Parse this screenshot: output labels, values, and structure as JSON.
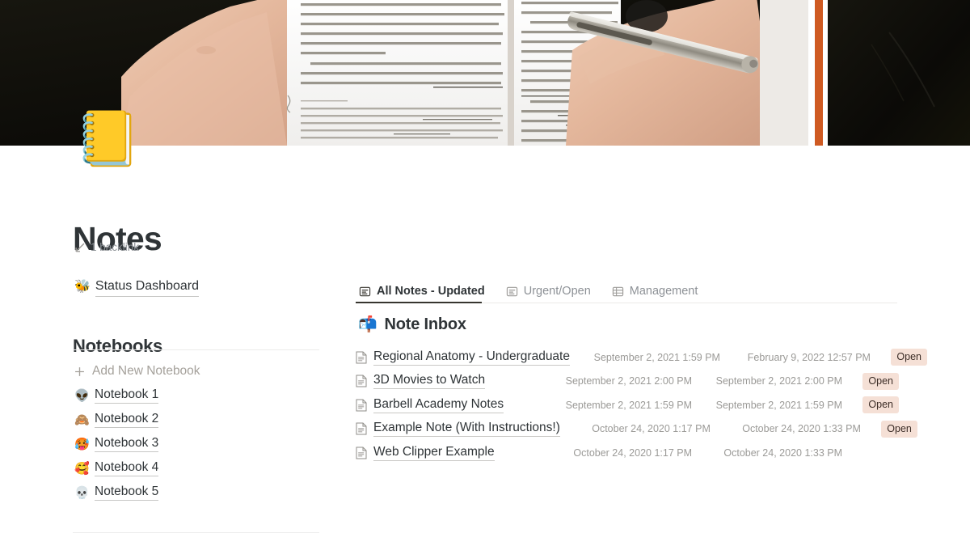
{
  "cover": {
    "alt": "hands writing with a pen in an open book"
  },
  "page": {
    "icon_emoji": "📒",
    "icon_name": "notebook-emoji",
    "title": "Notes",
    "backlink_label": "1 backlink"
  },
  "status_link": {
    "emoji": "🐝",
    "label": "Status Dashboard"
  },
  "notebooks": {
    "heading": "Notebooks",
    "add_label": "Add New Notebook",
    "items": [
      {
        "emoji": "👽",
        "label": "Notebook 1"
      },
      {
        "emoji": "🙈",
        "label": "Notebook 2"
      },
      {
        "emoji": "🥵",
        "label": "Notebook 3"
      },
      {
        "emoji": "🥰",
        "label": "Notebook 4"
      },
      {
        "emoji": "💀",
        "label": "Notebook 5"
      }
    ]
  },
  "tabs": [
    {
      "label": "All Notes - Updated",
      "icon": "list-view-icon",
      "active": true
    },
    {
      "label": "Urgent/Open",
      "icon": "list-view-icon",
      "active": false
    },
    {
      "label": "Management",
      "icon": "table-view-icon",
      "active": false
    }
  ],
  "inbox": {
    "emoji": "📬",
    "heading": "Note Inbox",
    "rows": [
      {
        "name": "Regional Anatomy - Undergraduate",
        "created": "September 2, 2021 1:59 PM",
        "updated": "February 9, 2022 12:57 PM",
        "status": "Open"
      },
      {
        "name": "3D Movies to Watch",
        "created": "September 2, 2021 2:00 PM",
        "updated": "September 2, 2021 2:00 PM",
        "status": "Open"
      },
      {
        "name": "Barbell Academy Notes",
        "created": "September 2, 2021 1:59 PM",
        "updated": "September 2, 2021 1:59 PM",
        "status": "Open"
      },
      {
        "name": "Example Note (With Instructions!)",
        "created": "October 24, 2020 1:17 PM",
        "updated": "October 24, 2020 1:33 PM",
        "status": "Open"
      },
      {
        "name": "Web Clipper Example",
        "created": "October 24, 2020 1:17 PM",
        "updated": "October 24, 2020 1:33 PM",
        "status": ""
      }
    ]
  },
  "colors": {
    "text": "#2f3437",
    "muted": "#9b9a97",
    "badge_bg": "#f5e0d6",
    "badge_text": "#3b2c26",
    "active_underline": "#37352f"
  }
}
